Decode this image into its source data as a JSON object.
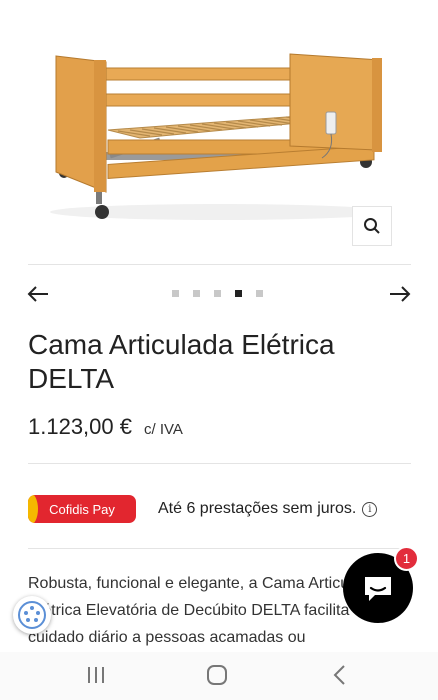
{
  "product": {
    "title": "Cama Articulada Elétrica DELTA",
    "price": "1.123,00 €",
    "tax_note": "c/ IVA",
    "image_alt": "electric-articulated-bed-photo"
  },
  "gallery": {
    "dot_count": 5,
    "active_dot": 4,
    "zoom_icon": "search-icon",
    "prev_icon": "arrow-left-icon",
    "next_icon": "arrow-right-icon"
  },
  "financing": {
    "brand": "Cofidis Pay",
    "text": "Até 6 prestações sem juros.",
    "info_icon": "info-icon",
    "brand_color": "#e2262f"
  },
  "description": {
    "text": "Robusta, funcional e elegante, a Cama Articulada Elétrica Elevatória de Decúbito DELTA facilita o cuidado diário a pessoas acamadas ou"
  },
  "chat": {
    "badge_count": "1",
    "icon": "chat-bubble-icon"
  },
  "accessibility": {
    "icon": "accessibility-icon"
  },
  "system_nav": {
    "recents_icon": "recents-icon",
    "home_icon": "home-icon",
    "back_icon": "back-icon"
  }
}
